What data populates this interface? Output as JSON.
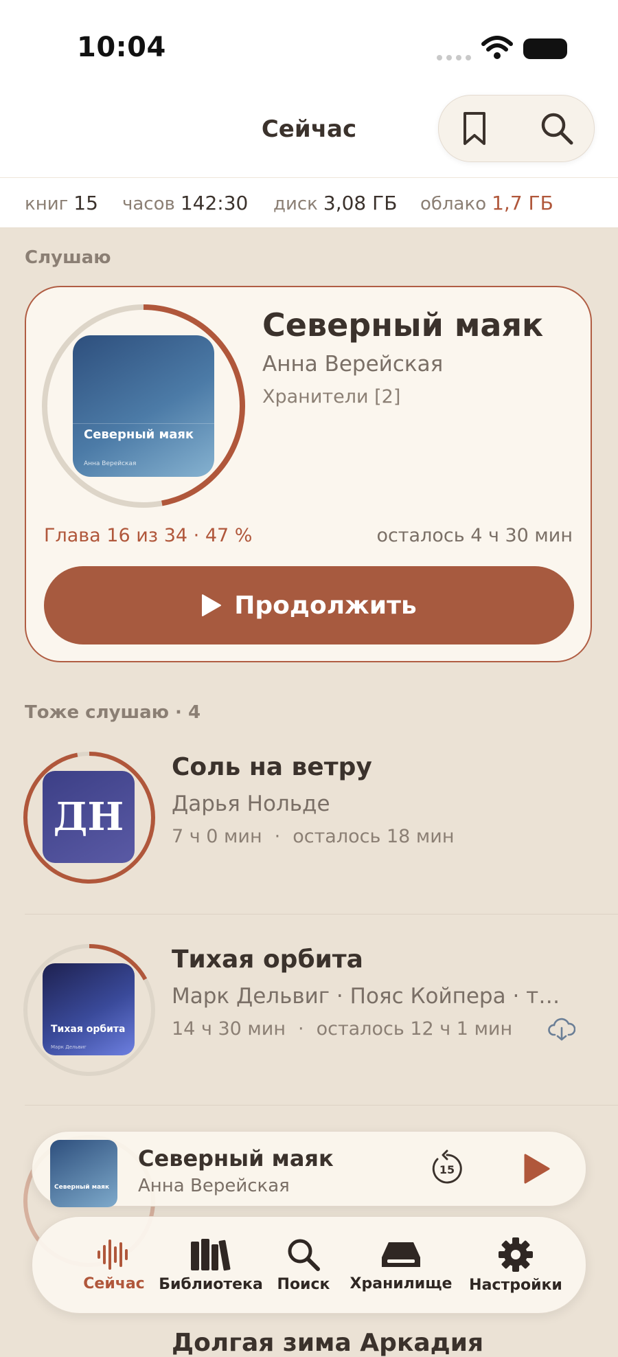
{
  "status_bar": {
    "time": "10:04"
  },
  "header": {
    "title": "Сейчас"
  },
  "stats": [
    {
      "label": "книг",
      "value": "15"
    },
    {
      "label": "часов",
      "value": "142:30"
    },
    {
      "label": "диск",
      "value": "3,08 ГБ"
    },
    {
      "label": "облако",
      "value": "1,7 ГБ"
    }
  ],
  "listening": {
    "section": "Слушаю",
    "title": "Северный маяк",
    "author": "Анна Верейская",
    "series": "Хранители [2]",
    "cover_title": "Северный маяк",
    "cover_author": "Анна Верейская",
    "chapter": "Глава 16 из 34 · 47 %",
    "progress": 0.47,
    "remaining": "осталось 4 ч 30 мин",
    "continue_label": "Продолжить"
  },
  "also": {
    "section": "Тоже слушаю · 4",
    "items": [
      {
        "title": "Соль на ветру",
        "author": "Дарья Нольде",
        "duration": "7 ч 0 мин",
        "remaining": "осталось 18 мин",
        "cover_text": "ДН",
        "progress": 0.97
      },
      {
        "title": "Тихая орбита",
        "author": "Марк Дельвиг · Пояс Койпера · то...",
        "duration": "14 ч 30 мин",
        "remaining": "осталось 12 ч 1 мин",
        "cover_title": "Тихая орбита",
        "cover_author": "Марк Дельвиг",
        "progress": 0.17,
        "cloud": true
      }
    ],
    "next_title_partial": "Долгая зима Аркадия"
  },
  "mini_player": {
    "title": "Северный маяк",
    "author": "Анна Верейская",
    "skip_back": "15",
    "cover_title": "Северный маяк"
  },
  "tabs": [
    {
      "label": "Сейчас",
      "icon": "waveform-icon",
      "active": true
    },
    {
      "label": "Библиотека",
      "icon": "books-icon"
    },
    {
      "label": "Поиск",
      "icon": "search-icon"
    },
    {
      "label": "Хранилище",
      "icon": "drive-icon"
    },
    {
      "label": "Настройки",
      "icon": "gear-icon"
    }
  ],
  "colors": {
    "accent": "#a75a3f",
    "background": "#ebe2d5",
    "card": "#fbf6ee"
  }
}
